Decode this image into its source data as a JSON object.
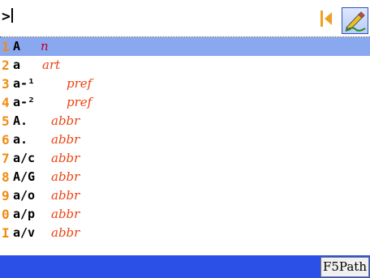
{
  "input": {
    "prompt_symbol": ">"
  },
  "results": [
    {
      "num": "1",
      "word": "A",
      "pos": "n",
      "selected": true
    },
    {
      "num": "2",
      "word": "a",
      "pos": "art"
    },
    {
      "num": "3",
      "word": "a-¹",
      "pos": "pref"
    },
    {
      "num": "4",
      "word": "a-²",
      "pos": "pref"
    },
    {
      "num": "5",
      "word": "A.",
      "pos": "abbr"
    },
    {
      "num": "6",
      "word": "a.",
      "pos": "abbr"
    },
    {
      "num": "7",
      "word": "a/c",
      "pos": "abbr"
    },
    {
      "num": "8",
      "word": "A/G",
      "pos": "abbr"
    },
    {
      "num": "9",
      "word": "a/o",
      "pos": "abbr"
    },
    {
      "num": "0",
      "word": "a/p",
      "pos": "abbr"
    },
    {
      "num": "I",
      "word": "a/v",
      "pos": "abbr"
    }
  ],
  "statusbar": {
    "f5_label": "F5Path"
  },
  "icons": {
    "nav": "first-page-icon",
    "edit": "edit-pencil-icon"
  },
  "colors": {
    "selection": "#8aa8f0",
    "status_bar": "#2a50e8",
    "numbers": "#f08c10",
    "part_of_speech": "#f04010"
  }
}
